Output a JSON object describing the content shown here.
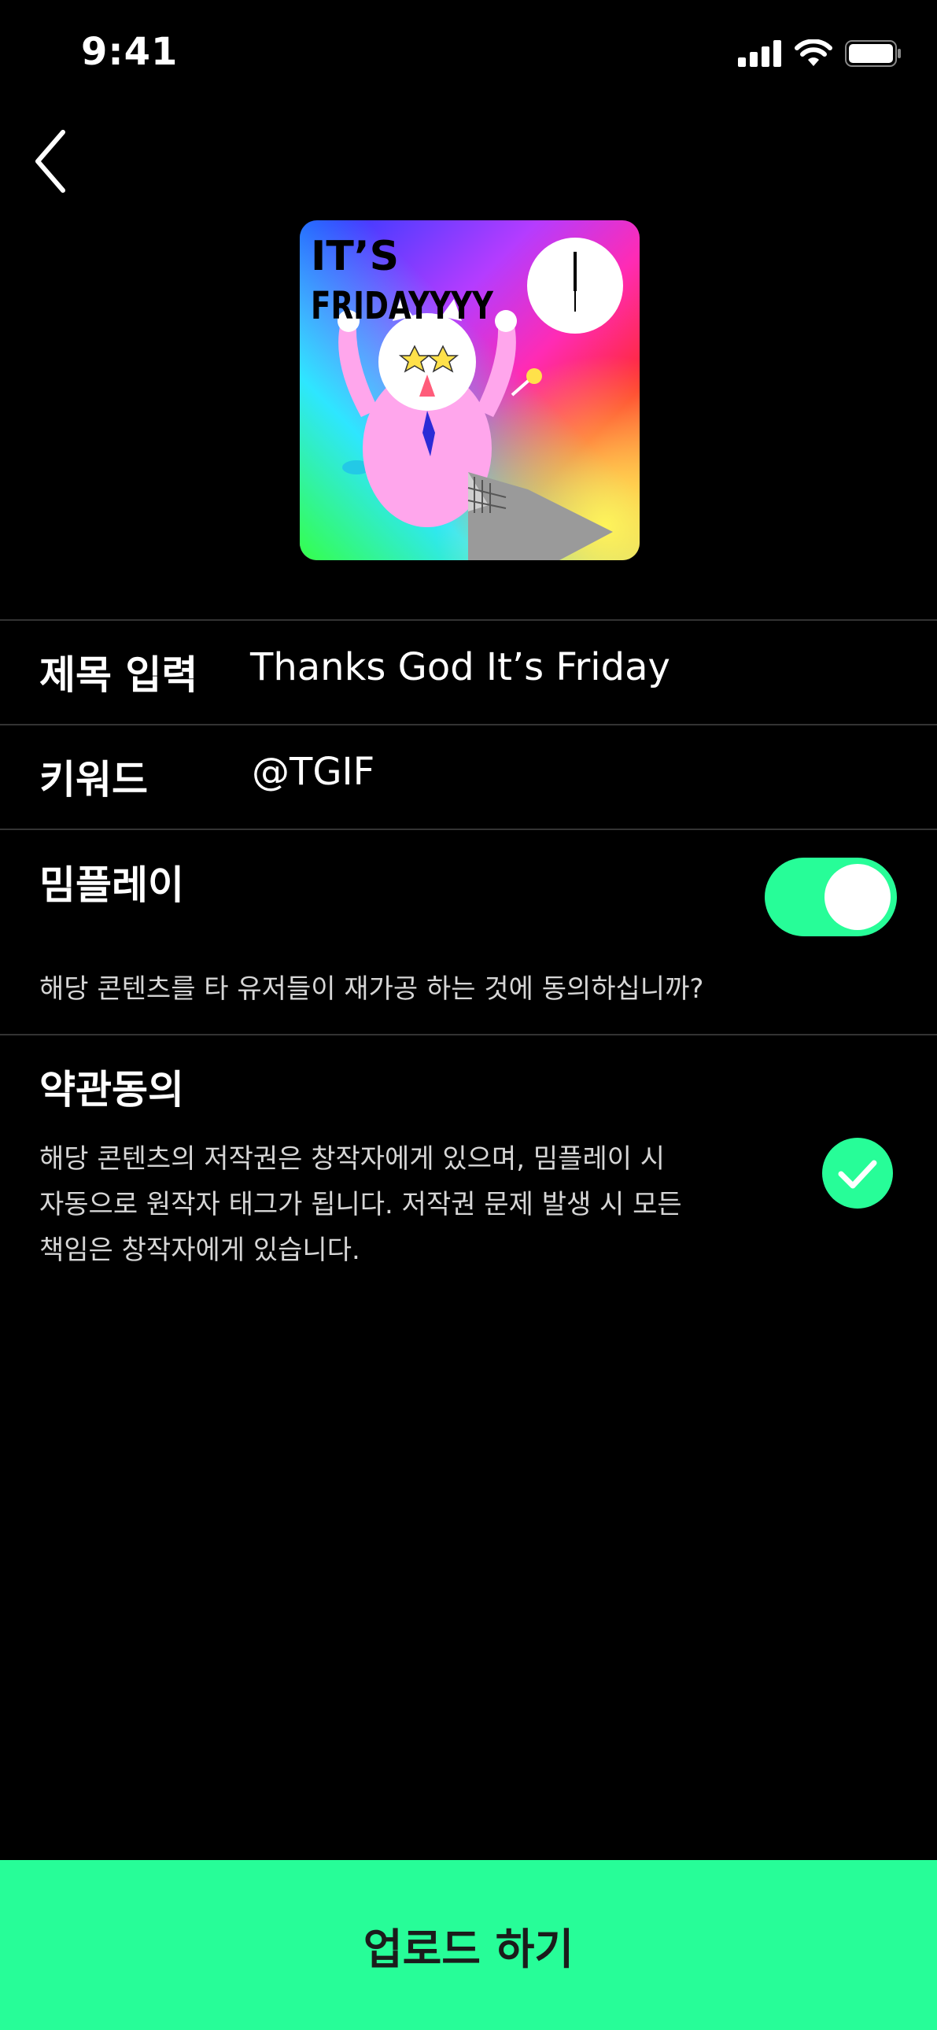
{
  "status_bar": {
    "time": "9:41"
  },
  "header": {
    "back_icon": "chevron-left-icon"
  },
  "thumbnail": {
    "text_line1": "IT’S",
    "text_line2": "FRIDAYYYY"
  },
  "form": {
    "title": {
      "label": "제목 입력",
      "value": "Thanks God It’s Friday"
    },
    "keyword": {
      "label": "키워드",
      "value": "@TGIF"
    },
    "memeplay": {
      "label": "밈플레이",
      "enabled": true,
      "description": "해당 콘텐츠를 타 유저들이 재가공 하는 것에 동의하십니까?"
    },
    "terms": {
      "label": "약관동의",
      "checked": true,
      "lines": [
        "해당 콘텐츠의 저작권은 창작자에게 있으며, 밈플레이 시",
        "자동으로 원작자 태그가 됩니다. 저작권 문제 발생 시 모든",
        "책임은 창작자에게 있습니다."
      ]
    }
  },
  "footer": {
    "upload_label": "업로드 하기"
  },
  "colors": {
    "accent": "#27fd98",
    "background": "#000000",
    "divider": "#333333"
  }
}
